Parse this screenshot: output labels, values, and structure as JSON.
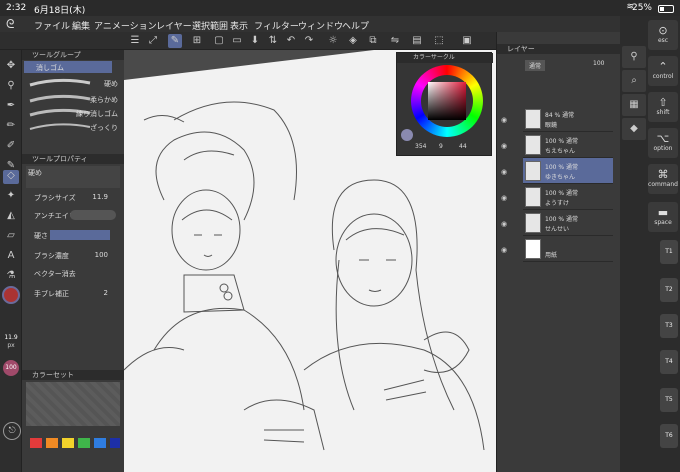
{
  "status": {
    "time": "2:32",
    "date": "6月18日(木)",
    "battery": "25%"
  },
  "menu": [
    "ファイル",
    "編集",
    "アニメーション",
    "レイヤー",
    "選択範囲",
    "表示",
    "フィルター",
    "ウィンドウ",
    "ヘルプ"
  ],
  "tool_panel": {
    "header": "ツールグループ",
    "tool_name": "消しゴム",
    "subtool_header_label": "硬め",
    "subtools": [
      "硬め",
      "柔らかめ",
      "練り消しゴム",
      "ざっくり"
    ],
    "property_header": "ツールプロパティ",
    "property_subtool": "硬め",
    "brush_size_label": "ブラシサイズ",
    "brush_size_value": "11.9",
    "antialias_label": "アンチエイリ",
    "hardness_label": "硬さ",
    "opacity_label": "ブラシ濃度",
    "opacity_value": "100",
    "vector_label": "ベクター消去",
    "stabilization_label": "手ブレ補正",
    "stabilization_value": "2",
    "size_readout": "11.9",
    "size_unit": "px",
    "zoom_readout": "100",
    "color_set_header": "カラーセット"
  },
  "color_wheel": {
    "header": "カラーサークル",
    "h": "354",
    "s": "9",
    "v": "44"
  },
  "layers": {
    "header": "レイヤー",
    "blend": "通常",
    "opacity": "100",
    "items": [
      {
        "opacity": "84 % 通常",
        "name": "眼鏡",
        "selected": false
      },
      {
        "opacity": "100 % 通常",
        "name": "ちえちゃん",
        "selected": false
      },
      {
        "opacity": "100 % 通常",
        "name": "ゆきちゃん",
        "selected": true
      },
      {
        "opacity": "100 % 通常",
        "name": "ようすけ",
        "selected": false
      },
      {
        "opacity": "100 % 通常",
        "name": "せんせい",
        "selected": false
      },
      {
        "opacity": "",
        "name": "用紙",
        "selected": false
      }
    ]
  },
  "keys": {
    "esc": "esc",
    "control": "control",
    "shift": "shift",
    "option": "option",
    "command": "command",
    "space": "space",
    "t": [
      "T1",
      "T2",
      "T3",
      "T4",
      "T5",
      "T6"
    ]
  },
  "colors": {
    "accent": "#5a6a9a",
    "swatches": [
      "#e23b3b",
      "#f08a24",
      "#f2d22b",
      "#3fb54a",
      "#2f7de0",
      "#1d2fa8"
    ]
  }
}
